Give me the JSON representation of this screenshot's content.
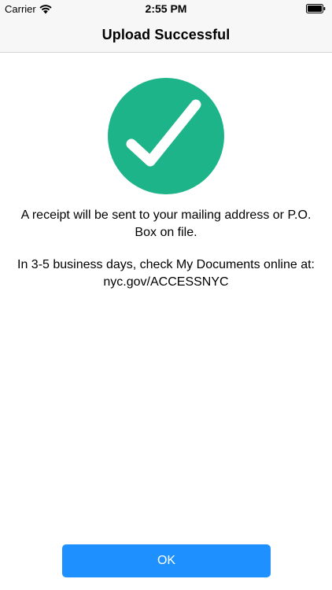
{
  "status_bar": {
    "carrier": "Carrier",
    "time": "2:55 PM",
    "wifi_icon": "wifi-icon",
    "battery_icon": "battery-icon"
  },
  "nav": {
    "title": "Upload Successful"
  },
  "success_icon": {
    "name": "checkmark-circle-icon",
    "color": "#1db489"
  },
  "messages": {
    "receipt": "A receipt will be sent to your mailing address or P.O. Box on file.",
    "documents_line1": "In 3-5 business days, check My Documents online at:",
    "documents_line2": "nyc.gov/ACCESSNYC"
  },
  "ok_button": {
    "label": "OK",
    "color": "#1e90ff"
  }
}
